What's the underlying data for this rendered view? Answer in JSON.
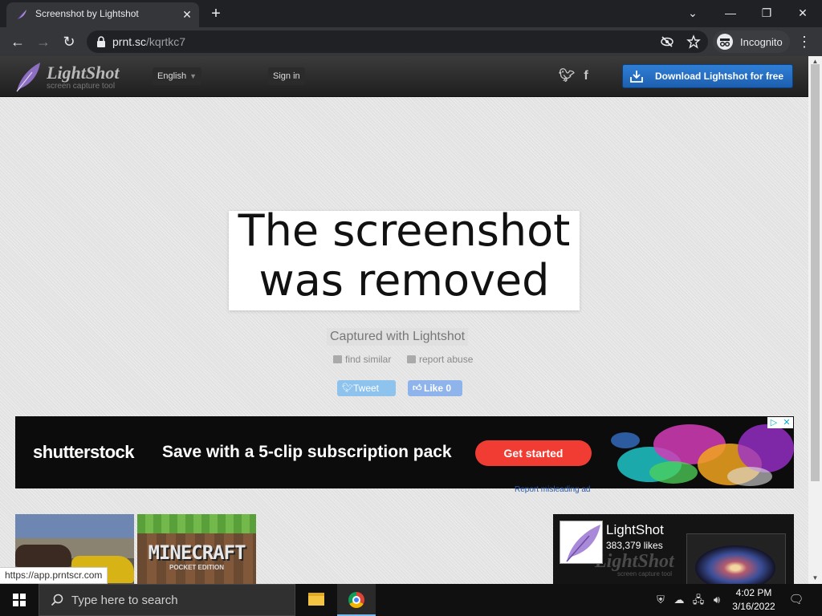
{
  "browser": {
    "tab_title": "Screenshot by Lightshot",
    "new_tab_symbol": "+",
    "close_symbol": "✕",
    "url_host": "prnt.sc",
    "url_path": "/kqrtkc7",
    "incognito_label": "Incognito",
    "window_controls": {
      "dropdown": "⌄",
      "minimize": "—",
      "restore": "❐",
      "close": "✕"
    }
  },
  "site": {
    "logo_name": "LightShot",
    "logo_tagline": "screen capture tool",
    "language": "English",
    "sign_in": "Sign in",
    "twitter_icon": "twitter-icon",
    "facebook_icon": "facebook-icon",
    "download_button": "Download Lightshot for free",
    "brand_color": "#1d5fb0"
  },
  "main": {
    "removed_line1": "The screenshot",
    "removed_line2": "was removed",
    "captured_with": "Captured with Lightshot",
    "find_similar": "find similar",
    "report_abuse": "report abuse",
    "tweet": "Tweet",
    "like": "Like 0"
  },
  "ad": {
    "brand": "shutterstock",
    "headline": "Save with a 5-clip subscription pack",
    "cta": "Get started",
    "report": "Report misleading ad",
    "cta_color": "#f03c32"
  },
  "thumbnails": {
    "minecraft_title": "MINECRAFT",
    "minecraft_subtitle": "POCKET EDITION"
  },
  "facebook_widget": {
    "page_name": "LightShot",
    "likes": "383,379 likes",
    "watermark": "LightShot",
    "watermark_tag": "screen capture tool"
  },
  "status_bar_url": "https://app.prntscr.com",
  "taskbar": {
    "search_placeholder": "Type here to search",
    "time": "4:02 PM",
    "date": "3/16/2022"
  }
}
